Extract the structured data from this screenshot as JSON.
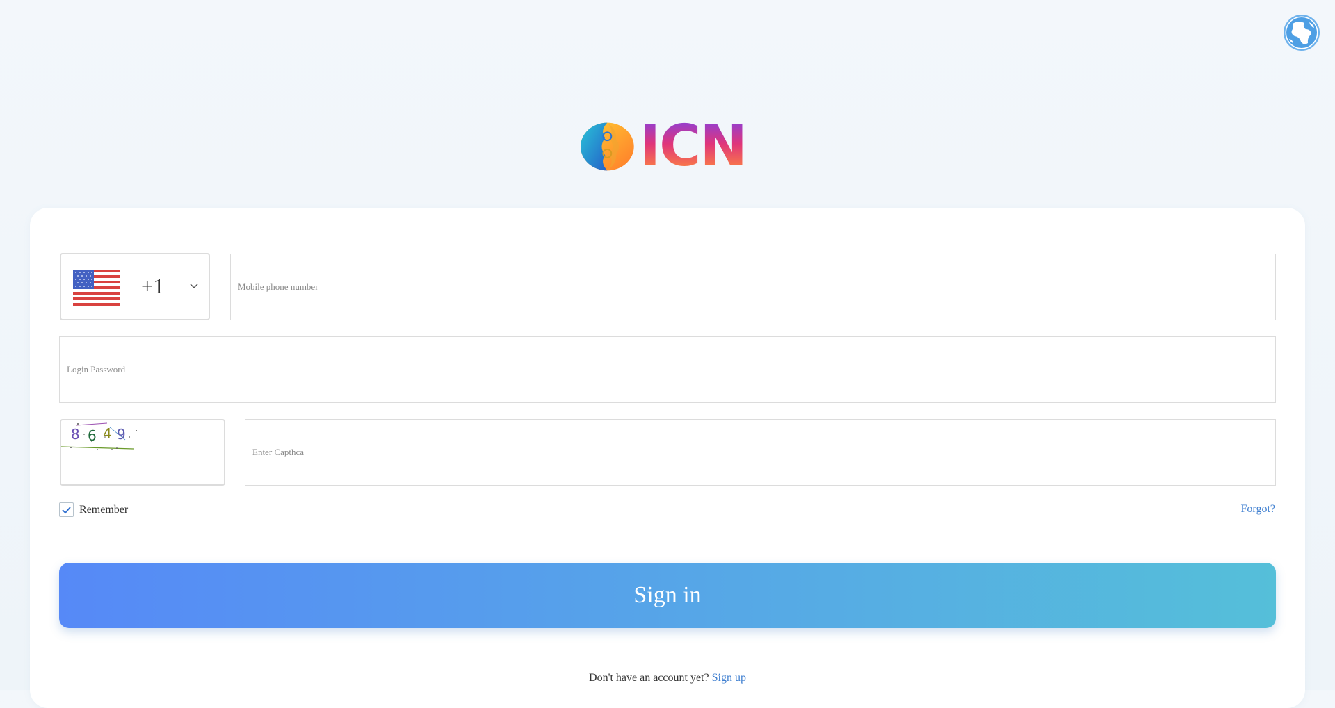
{
  "header": {
    "language_icon": "globe-icon"
  },
  "logo": {
    "text": "ICN",
    "emblem_icon": "icn-emblem-icon"
  },
  "form": {
    "country": {
      "flag_icon": "us-flag-icon",
      "dial_code": "+1",
      "dropdown_icon": "chevron-down-icon"
    },
    "phone": {
      "placeholder": "Mobile phone number",
      "value": ""
    },
    "password": {
      "placeholder": "Login Password",
      "value": ""
    },
    "captcha": {
      "code": [
        "8",
        "6",
        "4",
        "9"
      ],
      "placeholder": "Enter Capthca",
      "value": ""
    },
    "remember": {
      "label": "Remember",
      "checked": true
    },
    "forgot_label": "Forgot?",
    "signin_label": "Sign in",
    "signup_prompt": "Don't have an account yet?",
    "signup_label": "Sign up"
  },
  "colors": {
    "accent": "#3f7fd0",
    "button_start": "#5689f7",
    "button_end": "#55bfd9"
  }
}
